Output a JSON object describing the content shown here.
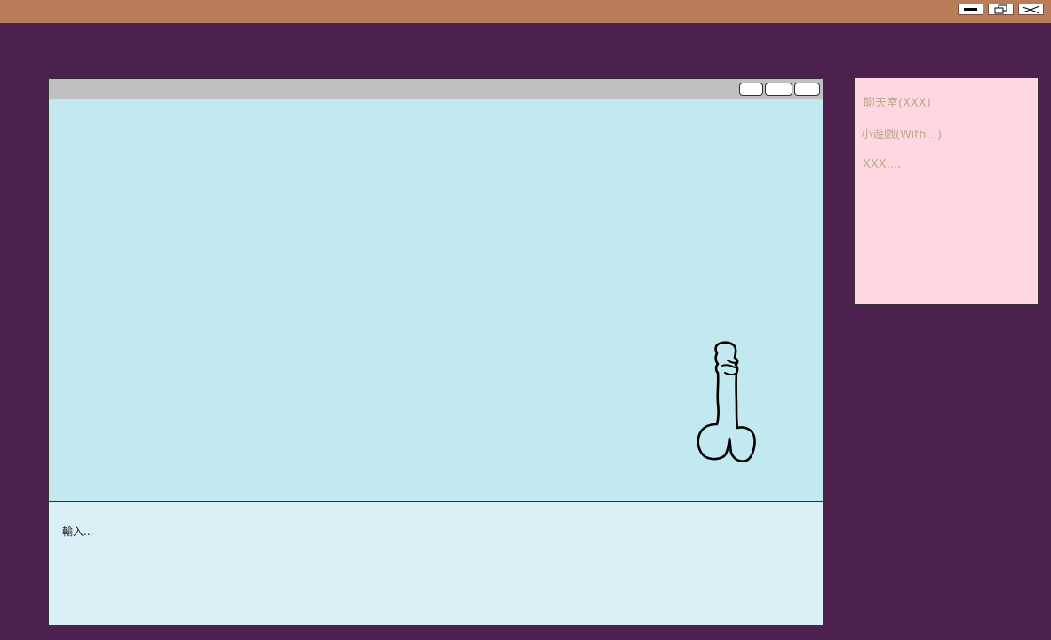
{
  "titlebar": {
    "color": "#b97b58",
    "buttons": [
      "minimize-icon",
      "restore-icon",
      "close-icon"
    ]
  },
  "chat": {
    "input_placeholder": "輸入...",
    "message_bg": "#c3e9f0",
    "input_bg": "#daf0f6"
  },
  "sidebar": {
    "items": [
      {
        "label": "聊天室(XXX)"
      },
      {
        "label": "小遊戲(With...)"
      },
      {
        "label": "XXX...."
      }
    ],
    "bg": "#ffd7e1"
  },
  "background": "#4d214d"
}
